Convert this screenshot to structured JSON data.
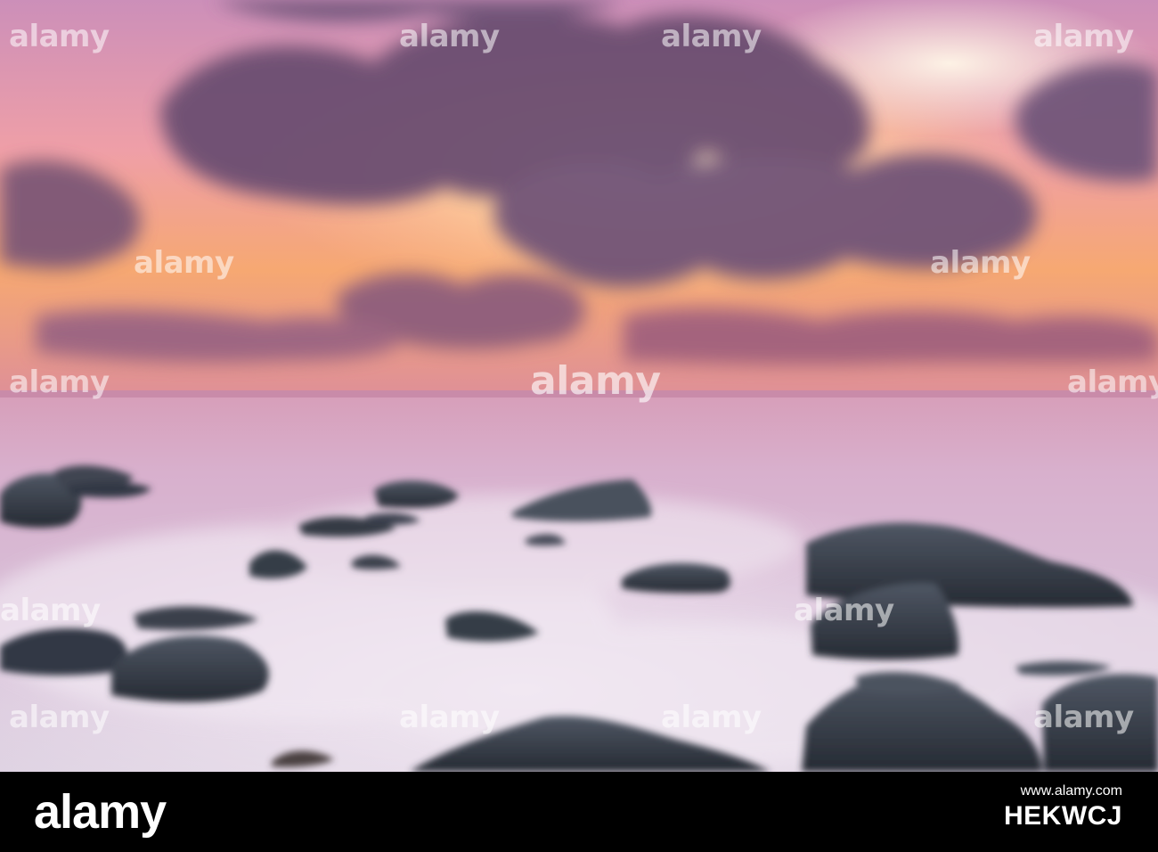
{
  "watermark": {
    "text": "alamy"
  },
  "footer": {
    "brand": "alamy",
    "caption": "www.alamy.com",
    "image_id": "HEKWCJ"
  },
  "colors": {
    "sky_top": "#cf92b8",
    "sky_glow": "#fff3d8",
    "horizon_orange": "#f5a76d",
    "cloud": "#6b4f72",
    "sea": "#d9b5cd",
    "mist": "#ece1ea",
    "rock": "#2f353f",
    "footer_bg": "#000000"
  }
}
